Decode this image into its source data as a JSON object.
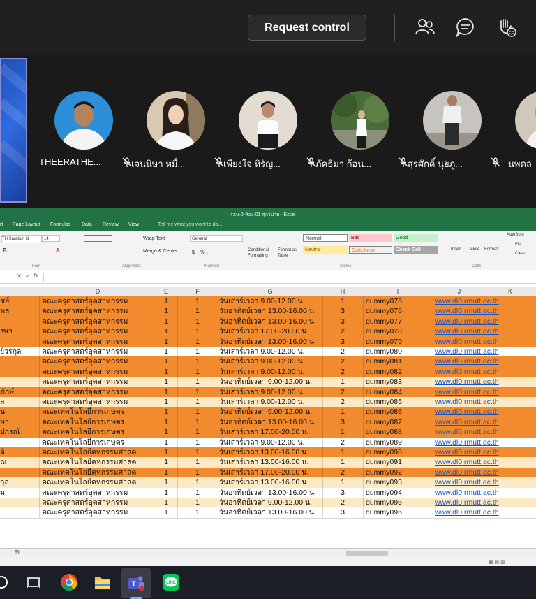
{
  "toolbar": {
    "request_control_label": "Request control"
  },
  "participants": [
    {
      "name": "THEERATHE...",
      "mic": "muted"
    },
    {
      "name": "เจนนิษา หมื่...",
      "mic": "muted"
    },
    {
      "name": "เพียงใจ หิรัญ...",
      "mic": "muted"
    },
    {
      "name": "ภัคธีมา ก้อน...",
      "mic": "muted"
    },
    {
      "name": "สุรศักดิ์ นุยภู...",
      "mic": "muted"
    },
    {
      "name": "นพดล",
      "mic": "unknown"
    }
  ],
  "excel": {
    "title": "รอบ-2-ห้อง-01 ศุกร์บ่าย - Excel",
    "tabs": [
      "rt",
      "Page Layout",
      "Formulas",
      "Data",
      "Review",
      "View",
      "Tell me what you want to do..."
    ],
    "ribbon": {
      "font_name": "TH Sarabun N",
      "font_size": "14",
      "wrap_text": "Wrap Text",
      "merge_center": "Merge & Center",
      "number_format": "General",
      "conditional_formatting": "Conditional Formatting",
      "format_as_table": "Format as Table",
      "style_normal": "Normal",
      "style_bad": "Bad",
      "style_good": "Good",
      "style_neutral": "Neutral",
      "style_calculation": "Calculation",
      "style_check_cell": "Check Cell",
      "insert": "Insert",
      "delete": "Delete",
      "format": "Format",
      "autosum": "AutoSum",
      "fill": "Fill",
      "clear": "Clear",
      "group_font": "Font",
      "group_alignment": "Alignment",
      "group_number": "Number",
      "group_styles": "Styles",
      "group_cells": "Cells"
    },
    "formula_fx": "fx",
    "columns": [
      "D",
      "E",
      "F",
      "G",
      "H",
      "I",
      "J",
      "K"
    ],
    "rows": [
      {
        "c": "ชย์",
        "d": "คณะครุศาสตร์อุตสาหกรรม",
        "e": "1",
        "f": "1",
        "g": "วันเสาร์เวลา 9.00-12.00 น.",
        "h": "1",
        "i": "dummy075",
        "j": "www.dl0.rmutt.ac.th",
        "bg": "#f28a2e"
      },
      {
        "c": "พล",
        "d": "คณะครุศาสตร์อุตสาหกรรม",
        "e": "1",
        "f": "1",
        "g": "วันอาทิตย์เวลา 13.00-16.00 น.",
        "h": "3",
        "i": "dummy076",
        "j": "www.dl0.rmutt.ac.th",
        "bg": "#f28a2e"
      },
      {
        "c": "",
        "d": "คณะครุศาสตร์อุตสาหกรรม",
        "e": "1",
        "f": "1",
        "g": "วันอาทิตย์เวลา 13.00-16.00 น.",
        "h": "3",
        "i": "dummy077",
        "j": "www.dl0.rmutt.ac.th",
        "bg": "#f28a2e"
      },
      {
        "c": "งษา",
        "d": "คณะครุศาสตร์อุตสาหกรรม",
        "e": "1",
        "f": "1",
        "g": "วันเสาร์เวลา 17.00-20.00 น.",
        "h": "2",
        "i": "dummy078",
        "j": "www.dl0.rmutt.ac.th",
        "bg": "#f28a2e"
      },
      {
        "c": "",
        "d": "คณะครุศาสตร์อุตสาหกรรม",
        "e": "1",
        "f": "1",
        "g": "วันอาทิตย์เวลา 13.00-16.00 น.",
        "h": "3",
        "i": "dummy079",
        "j": "www.dl0.rmutt.ac.th",
        "bg": "#f28a2e"
      },
      {
        "c": "ย์วรกุล",
        "d": "คณะครุศาสตร์อุตสาหกรรม",
        "e": "1",
        "f": "1",
        "g": "วันเสาร์เวลา 9.00-12.00 น.",
        "h": "2",
        "i": "dummy080",
        "j": "www.dl0.rmutt.ac.th",
        "bg": "#ffffff"
      },
      {
        "c": "",
        "d": "คณะครุศาสตร์อุตสาหกรรม",
        "e": "1",
        "f": "1",
        "g": "วันเสาร์เวลา 9.00-12.00 น.",
        "h": "2",
        "i": "dummy081",
        "j": "www.dl0.rmutt.ac.th",
        "bg": "#f28a2e"
      },
      {
        "c": "",
        "d": "คณะครุศาสตร์อุตสาหกรรม",
        "e": "1",
        "f": "1",
        "g": "วันเสาร์เวลา 9.00-12.00 น.",
        "h": "2",
        "i": "dummy082",
        "j": "www.dl0.rmutt.ac.th",
        "bg": "#f28a2e"
      },
      {
        "c": "",
        "d": "คณะครุศาสตร์อุตสาหกรรม",
        "e": "1",
        "f": "1",
        "g": "วันอาทิตย์เวลา 9.00-12.00 น.",
        "h": "1",
        "i": "dummy083",
        "j": "www.dl0.rmutt.ac.th",
        "bg": "#fde9c4"
      },
      {
        "c": "ภักษ์",
        "d": "คณะครุศาสตร์อุตสาหกรรม",
        "e": "1",
        "f": "1",
        "g": "วันเสาร์เวลา 9.00-12.00 น.",
        "h": "2",
        "i": "dummy084",
        "j": "www.dl0.rmutt.ac.th",
        "bg": "#f28a2e"
      },
      {
        "c": "ล",
        "d": "คณะครุศาสตร์อุตสาหกรรม",
        "e": "1",
        "f": "1",
        "g": "วันเสาร์เวลา 9.00-12.00 น.",
        "h": "2",
        "i": "dummy085",
        "j": "www.dl0.rmutt.ac.th",
        "bg": "#fde9c4"
      },
      {
        "c": "น",
        "d": "คณะเทคโนโลยีการเกษตร",
        "e": "1",
        "f": "1",
        "g": "วันอาทิตย์เวลา 9.00-12.00 น.",
        "h": "1",
        "i": "dummy086",
        "j": "www.dl0.rmutt.ac.th",
        "bg": "#f28a2e"
      },
      {
        "c": "ษา",
        "d": "คณะเทคโนโลยีการเกษตร",
        "e": "1",
        "f": "1",
        "g": "วันอาทิตย์เวลา 13.00-16.00 น.",
        "h": "3",
        "i": "dummy087",
        "j": "www.dl0.rmutt.ac.th",
        "bg": "#f28a2e"
      },
      {
        "c": "ปกรณ์",
        "d": "คณะเทคโนโลยีการเกษตร",
        "e": "1",
        "f": "1",
        "g": "วันเสาร์เวลา 17.00-20.00 น.",
        "h": "1",
        "i": "dummy088",
        "j": "www.dl0.rmutt.ac.th",
        "bg": "#f28a2e"
      },
      {
        "c": "",
        "d": "คณะเทคโนโลยีการเกษตร",
        "e": "1",
        "f": "1",
        "g": "วันเสาร์เวลา 9.00-12.00 น.",
        "h": "2",
        "i": "dummy089",
        "j": "www.dl0.rmutt.ac.th",
        "bg": "#ffffff"
      },
      {
        "c": "ติ",
        "d": "คณะเทคโนโลยีคหกรรมศาสต",
        "e": "1",
        "f": "1",
        "g": "วันเสาร์เวลา 13.00-16.00 น.",
        "h": "1",
        "i": "dummy090",
        "j": "www.dl0.rmutt.ac.th",
        "bg": "#f28a2e"
      },
      {
        "c": "ณ",
        "d": "คณะเทคโนโลยีคหกรรมศาสต",
        "e": "1",
        "f": "1",
        "g": "วันเสาร์เวลา 13.00-16.00 น.",
        "h": "1",
        "i": "dummy091",
        "j": "www.dl0.rmutt.ac.th",
        "bg": "#fde9c4"
      },
      {
        "c": "",
        "d": "คณะเทคโนโลยีคหกรรมศาสต",
        "e": "1",
        "f": "1",
        "g": "วันเสาร์เวลา 17.00-20.00 น.",
        "h": "2",
        "i": "dummy092",
        "j": "www.dl0.rmutt.ac.th",
        "bg": "#f28a2e"
      },
      {
        "c": "กุล",
        "d": "คณะเทคโนโลยีคหกรรมศาสต",
        "e": "1",
        "f": "1",
        "g": "วันเสาร์เวลา 13.00-16.00 น.",
        "h": "1",
        "i": "dummy093",
        "j": "www.dl0.rmutt.ac.th",
        "bg": "#fde9c4"
      },
      {
        "c": "ม",
        "d": "คณะครุศาสตร์อุตสาหกรรม",
        "e": "1",
        "f": "1",
        "g": "วันอาทิตย์เวลา 13.00-16.00 น.",
        "h": "3",
        "i": "dummy094",
        "j": "www.dl0.rmutt.ac.th",
        "bg": "#ffffff"
      },
      {
        "c": "",
        "d": "คณะครุศาสตร์อุตสาหกรรม",
        "e": "1",
        "f": "1",
        "g": "วันอาทิตย์เวลา 9.00-12.00 น.",
        "h": "2",
        "i": "dummy095",
        "j": "www.dl0.rmutt.ac.th",
        "bg": "#fde9c4"
      },
      {
        "c": "",
        "d": "คณะครุศาสตร์อุตสาหกรรม",
        "e": "1",
        "f": "1",
        "g": "วันอาทิตย์เวลา 13.00-16.00 น.",
        "h": "3",
        "i": "dummy096",
        "j": "www.dl0.rmutt.ac.th",
        "bg": "#ffffff"
      }
    ]
  },
  "taskbar": {
    "apps": [
      "search-icon",
      "task-view-icon",
      "chrome-icon",
      "file-explorer-icon",
      "teams-icon",
      "line-icon"
    ],
    "line_label": "LINE",
    "teams_label": "T"
  }
}
